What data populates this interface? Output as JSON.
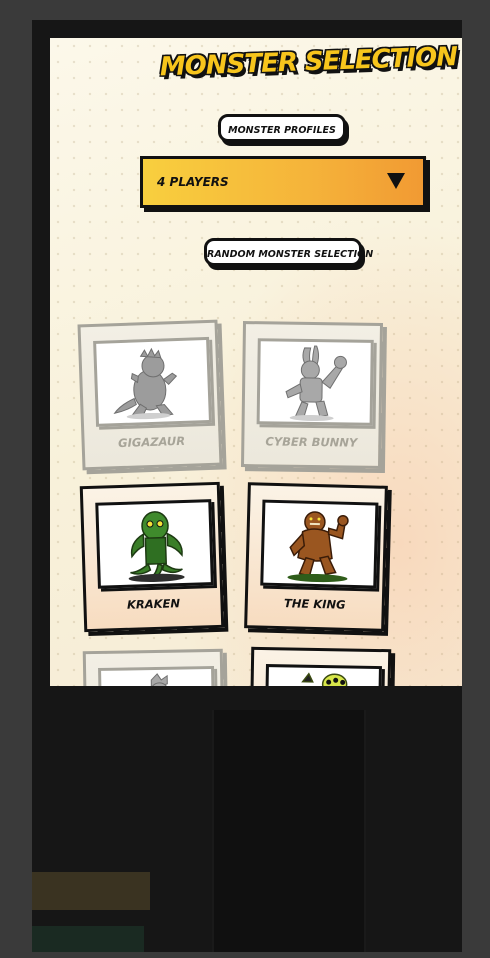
{
  "title": "MONSTER SELECTION",
  "profiles_button": "MONSTER PROFILES",
  "player_select": {
    "value": "4 PLAYERS"
  },
  "random_button": "RANDOM MONSTER SELECTION",
  "monsters": [
    {
      "name": "GIGAZAUR",
      "selectable": false,
      "icon": "gigazaur-icon"
    },
    {
      "name": "CYBER BUNNY",
      "selectable": false,
      "icon": "cyber-bunny-icon"
    },
    {
      "name": "KRAKEN",
      "selectable": true,
      "icon": "kraken-icon"
    },
    {
      "name": "THE KING",
      "selectable": true,
      "icon": "the-king-icon"
    },
    {
      "name": "",
      "selectable": false,
      "icon": "monster-icon"
    },
    {
      "name": "",
      "selectable": true,
      "icon": "alien-monster-icon"
    }
  ],
  "colors": {
    "title": "#f7c51c",
    "select_start": "#f8cf3e",
    "select_end": "#f19a33",
    "outline": "#111111",
    "disabled": "#a5a39a"
  }
}
